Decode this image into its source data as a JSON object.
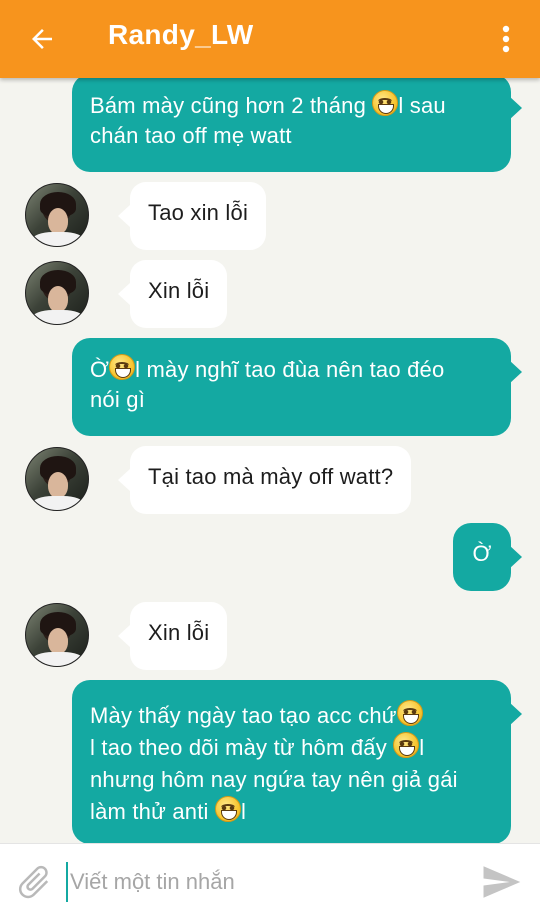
{
  "header": {
    "title": "Randy_LW",
    "back_icon": "arrow-left-icon",
    "menu_icon": "more-vertical-icon",
    "background": "#f7941d"
  },
  "colors": {
    "outgoing_bubble": "#14a9a2",
    "incoming_bubble": "#ffffff",
    "chat_background": "#f4f4ef"
  },
  "messages": [
    {
      "direction": "outgoing",
      "segments": [
        "Bám mày cũng hơn 2 tháng ",
        "l sau",
        "chán tao off mẹ watt"
      ]
    },
    {
      "direction": "incoming",
      "text": "Tao xin lỗi"
    },
    {
      "direction": "incoming",
      "text": "Xin lỗi"
    },
    {
      "direction": "outgoing",
      "segments": [
        "Ờ",
        "l mày nghĩ tao đùa nên tao đéo",
        "nói gì"
      ]
    },
    {
      "direction": "incoming",
      "text": "Tại tao mà mày off watt?"
    },
    {
      "direction": "outgoing",
      "text": "Ờ"
    },
    {
      "direction": "incoming",
      "text": "Xin lỗi"
    },
    {
      "direction": "outgoing",
      "segments": [
        "Mày thấy ngày tao tạo acc chứ",
        "l tao theo dõi mày từ hôm đấy ",
        "l",
        "nhưng hôm nay ngứa tay nên giả gái",
        "làm thử anti ",
        "l"
      ]
    }
  ],
  "composer": {
    "placeholder": "Viết một tin nhắn",
    "value": "",
    "attach_icon": "paperclip-icon",
    "send_icon": "send-icon"
  }
}
